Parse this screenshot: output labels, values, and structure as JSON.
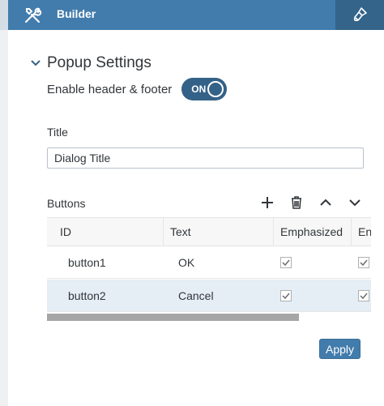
{
  "header": {
    "title": "Builder"
  },
  "popup_settings": {
    "section_title": "Popup Settings",
    "enable_header_footer": {
      "label": "Enable header & footer",
      "toggle_text": "ON",
      "value": true
    },
    "title_field": {
      "label": "Title",
      "value": "Dialog Title"
    }
  },
  "buttons_table": {
    "label": "Buttons",
    "columns": [
      "ID",
      "Text",
      "Emphasized",
      "En"
    ],
    "rows": [
      {
        "id": "button1",
        "text": "OK",
        "emphasized": true,
        "enabled": true
      },
      {
        "id": "button2",
        "text": "Cancel",
        "emphasized": true,
        "enabled": true
      }
    ],
    "selected_row": 1
  },
  "footer": {
    "apply_label": "Apply"
  },
  "icons": [
    "tools-icon",
    "paintbrush-icon",
    "chevron-down-icon",
    "add-icon",
    "delete-icon",
    "move-up-icon",
    "move-down-icon",
    "checkbox-checked-icon"
  ],
  "colors": {
    "header_bg": "#427cac",
    "toggle_bg": "#346187",
    "selected_row": "#e5edf5",
    "apply_bg": "#427cac"
  }
}
